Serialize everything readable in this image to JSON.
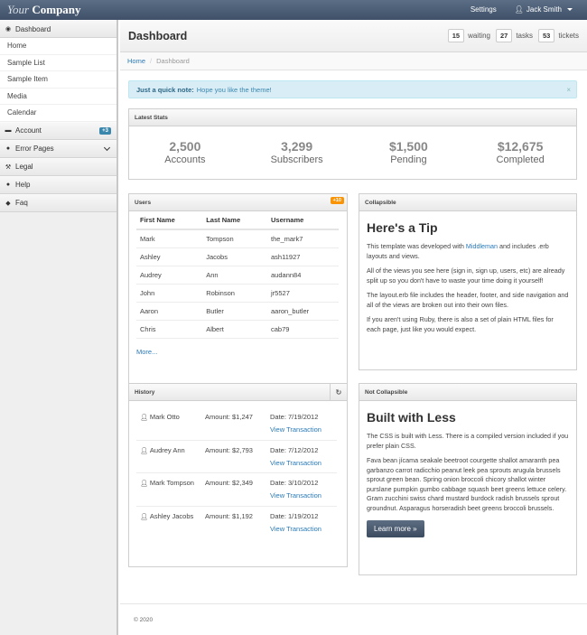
{
  "brand": {
    "part1": "Your",
    "part2": "Company"
  },
  "topnav": {
    "settings": "Settings",
    "user": "Jack Smith"
  },
  "sidebar": {
    "dashboard": "Dashboard",
    "items": [
      "Home",
      "Sample List",
      "Sample Item",
      "Media",
      "Calendar"
    ],
    "account": "Account",
    "account_badge": "+3",
    "error_pages": "Error Pages",
    "legal": "Legal",
    "help": "Help",
    "faq": "Faq"
  },
  "header": {
    "title": "Dashboard",
    "stats": [
      {
        "num": "15",
        "label": "waiting"
      },
      {
        "num": "27",
        "label": "tasks"
      },
      {
        "num": "53",
        "label": "tickets"
      }
    ]
  },
  "breadcrumb": {
    "home": "Home",
    "current": "Dashboard"
  },
  "alert": {
    "strong": "Just a quick note:",
    "text": "Hope you like the theme!",
    "close": "×"
  },
  "latest_stats": {
    "title": "Latest Stats",
    "items": [
      {
        "value": "2,500",
        "label": "Accounts"
      },
      {
        "value": "3,299",
        "label": "Subscribers"
      },
      {
        "value": "$1,500",
        "label": "Pending"
      },
      {
        "value": "$12,675",
        "label": "Completed"
      }
    ]
  },
  "users": {
    "title": "Users",
    "badge": "+10",
    "columns": [
      "First Name",
      "Last Name",
      "Username"
    ],
    "rows": [
      [
        "Mark",
        "Tompson",
        "the_mark7"
      ],
      [
        "Ashley",
        "Jacobs",
        "ash11927"
      ],
      [
        "Audrey",
        "Ann",
        "audann84"
      ],
      [
        "John",
        "Robinson",
        "jr5527"
      ],
      [
        "Aaron",
        "Butler",
        "aaron_butler"
      ],
      [
        "Chris",
        "Albert",
        "cab79"
      ]
    ],
    "more": "More..."
  },
  "tip": {
    "head": "Collapsible",
    "title": "Here's a Tip",
    "p1_pre": "This template was developed with ",
    "p1_link": "Middleman",
    "p1_post": " and includes .erb layouts and views.",
    "p2": "All of the views you see here (sign in, sign up, users, etc) are already split up so you don't have to waste your time doing it yourself!",
    "p3": "The layout.erb file includes the header, footer, and side navigation and all of the views are broken out into their own files.",
    "p4": "If you aren't using Ruby, there is also a set of plain HTML files for each page, just like you would expect."
  },
  "history": {
    "title": "History",
    "rows": [
      {
        "name": "Mark Otto",
        "amount": "Amount: $1,247",
        "date": "Date: 7/19/2012",
        "link": "View Transaction"
      },
      {
        "name": "Audrey Ann",
        "amount": "Amount: $2,793",
        "date": "Date: 7/12/2012",
        "link": "View Transaction"
      },
      {
        "name": "Mark Tompson",
        "amount": "Amount: $2,349",
        "date": "Date: 3/10/2012",
        "link": "View Transaction"
      },
      {
        "name": "Ashley Jacobs",
        "amount": "Amount: $1,192",
        "date": "Date: 1/19/2012",
        "link": "View Transaction"
      }
    ]
  },
  "less": {
    "head": "Not Collapsible",
    "title": "Built with Less",
    "p1": "The CSS is built with Less. There is a compiled version included if you prefer plain CSS.",
    "p2": "Fava bean jícama seakale beetroot courgette shallot amaranth pea garbanzo carrot radicchio peanut leek pea sprouts arugula brussels sprout green bean. Spring onion broccoli chicory shallot winter purslane pumpkin gumbo cabbage squash beet greens lettuce celery. Gram zucchini swiss chard mustard burdock radish brussels sprout groundnut. Asparagus horseradish beet greens broccoli brussels.",
    "button": "Learn more »"
  },
  "footer": "© 2020"
}
